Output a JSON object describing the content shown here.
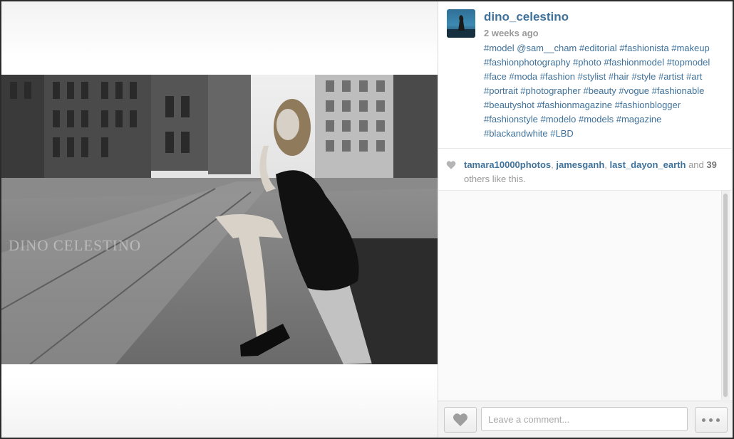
{
  "post": {
    "username": "dino_celestino",
    "timestamp": "2 weeks ago",
    "caption": "#model @sam__cham #editorial #fashionista #makeup #fashionphotography #photo #fashionmodel #topmodel #face #moda #fashion #stylist #hair #style #artist #art #portrait #photographer #beauty #vogue #fashionable #beautyshot #fashionmagazine #fashionblogger #fashionstyle #modelo #models #magazine #blackandwhite #LBD",
    "photo_watermark": "DINO CELESTINO"
  },
  "likes": {
    "users": [
      "tamara10000photos",
      "jamesganh",
      "last_dayon_earth"
    ],
    "separator": ", ",
    "and_text": "and",
    "others_count": "39",
    "others_text": "others like this."
  },
  "footer": {
    "comment_placeholder": "Leave a comment...",
    "like_icon": "heart-icon",
    "more_icon": "ellipsis-icon"
  },
  "colors": {
    "link": "#3f729b",
    "muted": "#999999",
    "heart_gray": "#b5b5b5"
  }
}
